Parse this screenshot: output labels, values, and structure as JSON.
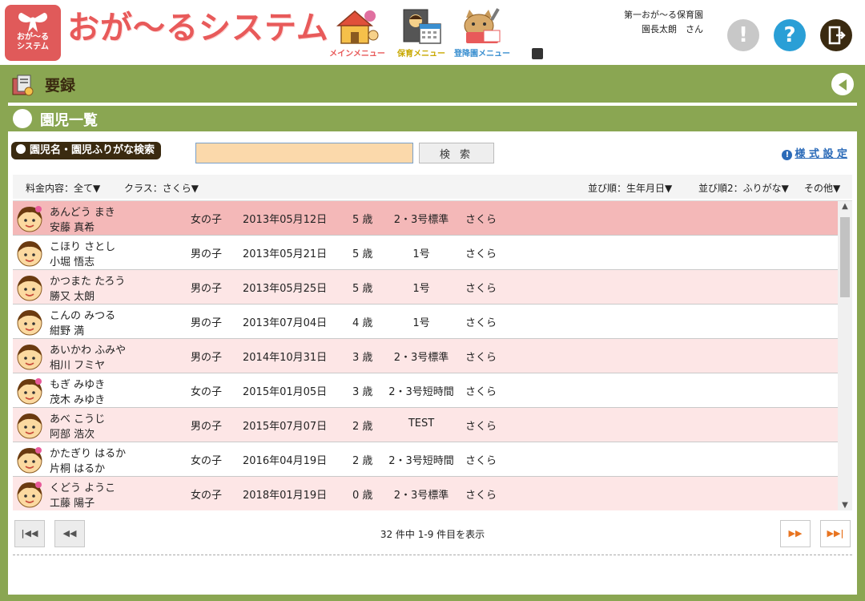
{
  "header": {
    "logo_text": "おが〜る\nシステム",
    "logo_line1": "おが〜る",
    "logo_line2": "システム",
    "app_title": "おが〜るシステム",
    "menus": [
      {
        "label": "メインメニュー",
        "icon": "house-icon"
      },
      {
        "label": "保育メニュー",
        "icon": "calendar-icon"
      },
      {
        "label": "登降園メニュー",
        "icon": "cat-card-icon"
      }
    ],
    "facility": "第一おが〜る保育園",
    "user": "園長太朗　さん",
    "buttons": {
      "alert": "alert-icon",
      "help": "help-icon",
      "logout": "logout-icon"
    },
    "colors": {
      "brand": "#e85a5a",
      "alert": "#c8c8c8",
      "help": "#2a9fd6",
      "logout": "#3a2a10"
    }
  },
  "section": {
    "title": "要録",
    "accent": "#8aa652"
  },
  "panel": {
    "title": "園児一覧"
  },
  "search": {
    "label": "園児名・園児ふりがな検索",
    "value": "",
    "placeholder": "",
    "button": "検 索"
  },
  "style_link": "様 式 設 定",
  "filters": {
    "fee": "料金内容：全て▼",
    "class": "クラス：さくら▼",
    "sort1": "並び順：生年月日▼",
    "sort2": "並び順2：ふりがな▼",
    "other": "その他▼"
  },
  "children": [
    {
      "kana": "あんどう まき",
      "name": "安藤 真希",
      "gender": "女の子",
      "birth": "2013年05月12日",
      "age": "5 歳",
      "fee": "2・3号標準",
      "klass": "さくら"
    },
    {
      "kana": "こほり さとし",
      "name": "小堀 悟志",
      "gender": "男の子",
      "birth": "2013年05月21日",
      "age": "5 歳",
      "fee": "1号",
      "klass": "さくら"
    },
    {
      "kana": "かつまた たろう",
      "name": "勝又 太朗",
      "gender": "男の子",
      "birth": "2013年05月25日",
      "age": "5 歳",
      "fee": "1号",
      "klass": "さくら"
    },
    {
      "kana": "こんの みつる",
      "name": "紺野 満",
      "gender": "男の子",
      "birth": "2013年07月04日",
      "age": "4 歳",
      "fee": "1号",
      "klass": "さくら"
    },
    {
      "kana": "あいかわ ふみや",
      "name": "相川 フミヤ",
      "gender": "男の子",
      "birth": "2014年10月31日",
      "age": "3 歳",
      "fee": "2・3号標準",
      "klass": "さくら"
    },
    {
      "kana": "もぎ みゆき",
      "name": "茂木 みゆき",
      "gender": "女の子",
      "birth": "2015年01月05日",
      "age": "3 歳",
      "fee": "2・3号短時間",
      "klass": "さくら"
    },
    {
      "kana": "あべ こうじ",
      "name": "阿部 浩次",
      "gender": "男の子",
      "birth": "2015年07月07日",
      "age": "2 歳",
      "fee": "TEST",
      "klass": "さくら"
    },
    {
      "kana": "かたぎり はるか",
      "name": "片桐 はるか",
      "gender": "女の子",
      "birth": "2016年04月19日",
      "age": "2 歳",
      "fee": "2・3号短時間",
      "klass": "さくら"
    },
    {
      "kana": "くどう ようこ",
      "name": "工藤 陽子",
      "gender": "女の子",
      "birth": "2018年01月19日",
      "age": "0 歳",
      "fee": "2・3号標準",
      "klass": "さくら"
    }
  ],
  "pager": {
    "info": "32 件中 1-9 件目を表示",
    "first": "first-page-icon",
    "prev": "prev-page-icon",
    "next": "next-page-icon",
    "last": "last-page-icon"
  }
}
